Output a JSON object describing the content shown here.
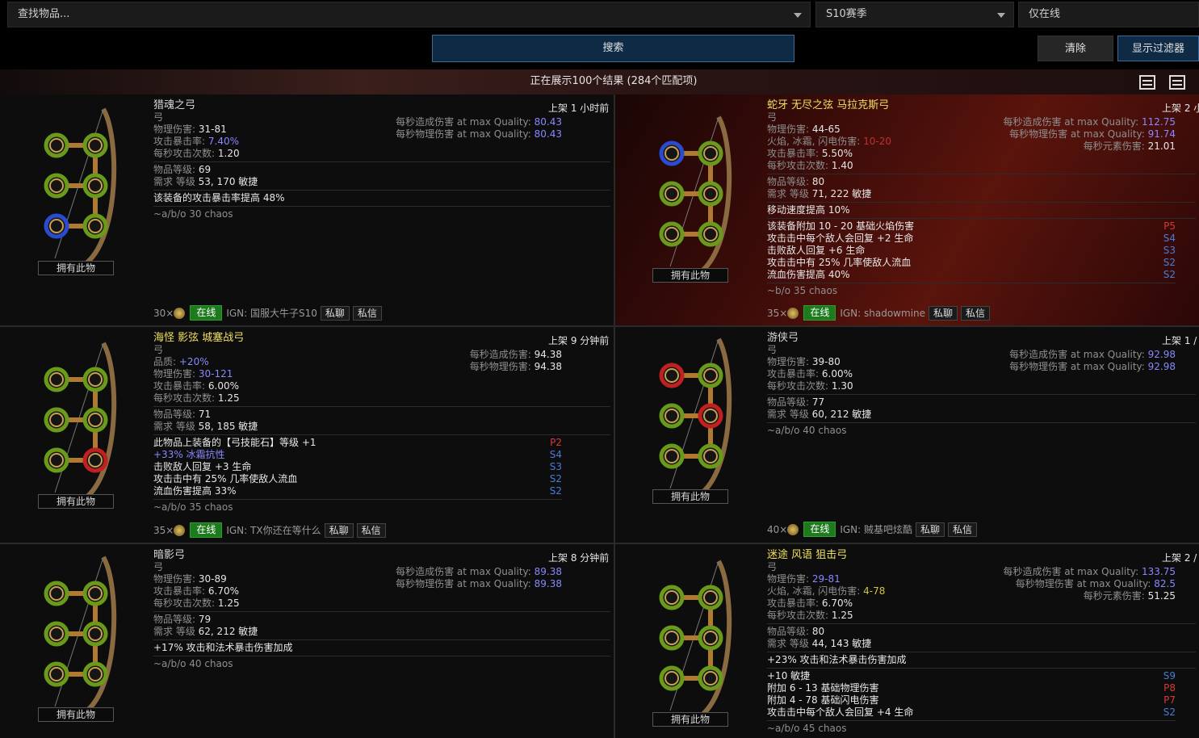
{
  "search": {
    "item_placeholder": "查找物品...",
    "league": "S10赛季",
    "status": "仅在线"
  },
  "buttons": {
    "search": "搜索",
    "clear": "清除",
    "show_filters": "显示过滤器"
  },
  "results_text": "正在展示100个结果 (284个匹配项)",
  "labels": {
    "own": "拥有此物",
    "online": "在线",
    "whisper": "私聊",
    "message": "私信"
  },
  "items": [
    {
      "title": "猎魂之弓",
      "type": "弓",
      "listed": "上架 1 小时前",
      "magic": false,
      "stats": [
        {
          "label": "物理伤害:",
          "value": "31-81",
          "cls": "val"
        },
        {
          "label": "攻击暴击率:",
          "value": "7.40%",
          "cls": "blue"
        },
        {
          "label": "每秒攻击次数:",
          "value": "1.20",
          "cls": "val"
        }
      ],
      "level": "69",
      "req": "53, 170 敏捷",
      "implicit": "该装备的攻击暴击率提高 48%",
      "mods": [],
      "price": "~a/b/o 30 chaos",
      "dps": [
        {
          "label": "每秒造成伤害 at max Quality:",
          "value": "80.43"
        },
        {
          "label": "每秒物理伤害 at max Quality:",
          "value": "80.43"
        }
      ],
      "count": "30×",
      "ign": "IGN: 国服大牛子S10"
    },
    {
      "title": "蛇牙 无尽之弦 马拉克斯弓",
      "type": "弓",
      "listed": "上架 2 小",
      "magic": true,
      "stats": [
        {
          "label": "物理伤害:",
          "value": "44-65",
          "cls": "val"
        },
        {
          "label": "火焰, 冰霜, 闪电伤害:",
          "value": "10-20",
          "cls": "red"
        },
        {
          "label": "攻击暴击率:",
          "value": "5.50%",
          "cls": "val"
        },
        {
          "label": "每秒攻击次数:",
          "value": "1.40",
          "cls": "val"
        }
      ],
      "level": "80",
      "req": "71, 222 敏捷",
      "implicit": "移动速度提高 10%",
      "mods": [
        {
          "text": "该装备附加 10 - 20 基础火焰伤害",
          "tag": "P5",
          "t": "p"
        },
        {
          "text": "攻击击中每个敌人会回复 +2 生命",
          "tag": "S4",
          "t": "s"
        },
        {
          "text": "击败敌人回复 +6 生命",
          "tag": "S3",
          "t": "s"
        },
        {
          "text": "攻击击中有 25% 几率使敌人流血",
          "tag": "S2",
          "t": "s"
        },
        {
          "text": "流血伤害提高 40%",
          "tag": "S2",
          "t": "s"
        }
      ],
      "price": "~b/o 35 chaos",
      "dps": [
        {
          "label": "每秒造成伤害 at max Quality:",
          "value": "112.75"
        },
        {
          "label": "每秒物理伤害 at max Quality:",
          "value": "91.74"
        },
        {
          "label": "每秒元素伤害:",
          "value": "21.01"
        }
      ],
      "count": "35×",
      "ign": "IGN: shadowmine"
    },
    {
      "title": "海怪 影弦 城塞战弓",
      "type": "弓",
      "listed": "上架 9 分钟前",
      "magic": true,
      "stats": [
        {
          "label": "品质:",
          "value": "+20%",
          "cls": "blue"
        },
        {
          "label": "物理伤害:",
          "value": "30-121",
          "cls": "blue"
        },
        {
          "label": "攻击暴击率:",
          "value": "6.00%",
          "cls": "val"
        },
        {
          "label": "每秒攻击次数:",
          "value": "1.25",
          "cls": "val"
        }
      ],
      "level": "71",
      "req": "58, 185 敏捷",
      "implicit": "",
      "mods": [
        {
          "text": "此物品上装备的【弓技能石】等级 +1",
          "tag": "P2",
          "t": "p"
        },
        {
          "text": "+33% 冰霜抗性",
          "tag": "S4",
          "t": "s",
          "blue": true
        },
        {
          "text": "击败敌人回复 +3 生命",
          "tag": "S3",
          "t": "s"
        },
        {
          "text": "攻击击中有 25% 几率使敌人流血",
          "tag": "S2",
          "t": "s"
        },
        {
          "text": "流血伤害提高 33%",
          "tag": "S2",
          "t": "s"
        }
      ],
      "price": "~a/b/o 35 chaos",
      "dps": [
        {
          "label": "每秒造成伤害:",
          "value": "94.38"
        },
        {
          "label": "每秒物理伤害:",
          "value": "94.38"
        }
      ],
      "count": "35×",
      "ign": "IGN: TX你还在等什么"
    },
    {
      "title": "游侠弓",
      "type": "弓",
      "listed": "上架 1 /",
      "magic": false,
      "stats": [
        {
          "label": "物理伤害:",
          "value": "39-80",
          "cls": "val"
        },
        {
          "label": "攻击暴击率:",
          "value": "6.00%",
          "cls": "val"
        },
        {
          "label": "每秒攻击次数:",
          "value": "1.30",
          "cls": "val"
        }
      ],
      "level": "77",
      "req": "60, 212 敏捷",
      "implicit": "",
      "mods": [],
      "price": "~a/b/o 40 chaos",
      "dps": [
        {
          "label": "每秒造成伤害 at max Quality:",
          "value": "92.98"
        },
        {
          "label": "每秒物理伤害 at max Quality:",
          "value": "92.98"
        }
      ],
      "count": "40×",
      "ign": "IGN: 贼基吧炫酷"
    },
    {
      "title": "暗影弓",
      "type": "弓",
      "listed": "上架 8 分钟前",
      "magic": false,
      "stats": [
        {
          "label": "物理伤害:",
          "value": "30-89",
          "cls": "val"
        },
        {
          "label": "攻击暴击率:",
          "value": "6.70%",
          "cls": "val"
        },
        {
          "label": "每秒攻击次数:",
          "value": "1.25",
          "cls": "val"
        }
      ],
      "level": "79",
      "req": "62, 212 敏捷",
      "implicit": "+17% 攻击和法术暴击伤害加成",
      "mods": [],
      "price": "~a/b/o 40 chaos",
      "dps": [
        {
          "label": "每秒造成伤害 at max Quality:",
          "value": "89.38"
        },
        {
          "label": "每秒物理伤害 at max Quality:",
          "value": "89.38"
        }
      ],
      "count": "",
      "ign": ""
    },
    {
      "title": "迷途 风语 狙击弓",
      "type": "弓",
      "listed": "上架 2 /",
      "magic": true,
      "stats": [
        {
          "label": "物理伤害:",
          "value": "29-81",
          "cls": "blue"
        },
        {
          "label": "火焰, 冰霜, 闪电伤害:",
          "value": "4-78",
          "cls": "ylw"
        },
        {
          "label": "攻击暴击率:",
          "value": "6.70%",
          "cls": "val"
        },
        {
          "label": "每秒攻击次数:",
          "value": "1.25",
          "cls": "val"
        }
      ],
      "level": "80",
      "req": "44, 143 敏捷",
      "implicit": "+23% 攻击和法术暴击伤害加成",
      "mods": [
        {
          "text": "+10 敏捷",
          "tag": "S9",
          "t": "s"
        },
        {
          "text": "附加 6 - 13 基础物理伤害",
          "tag": "P8",
          "t": "p"
        },
        {
          "text": "附加 4 - 78 基础闪电伤害",
          "tag": "P7",
          "t": "p"
        },
        {
          "text": "攻击击中每个敌人会回复 +4 生命",
          "tag": "S2",
          "t": "s"
        }
      ],
      "price": "~a/b/o 45 chaos",
      "dps": [
        {
          "label": "每秒造成伤害 at max Quality:",
          "value": "133.75"
        },
        {
          "label": "每秒物理伤害 at max Quality:",
          "value": "82.5"
        },
        {
          "label": "每秒元素伤害:",
          "value": "51.25"
        }
      ],
      "count": "",
      "ign": ""
    }
  ],
  "socket_colors": {
    "green": "#6a9a1a",
    "blue": "#2a4ad0",
    "red": "#c02020",
    "link": "#b07a30"
  },
  "static_labels": {
    "level": "物品等级:",
    "req": "需求 等级"
  }
}
